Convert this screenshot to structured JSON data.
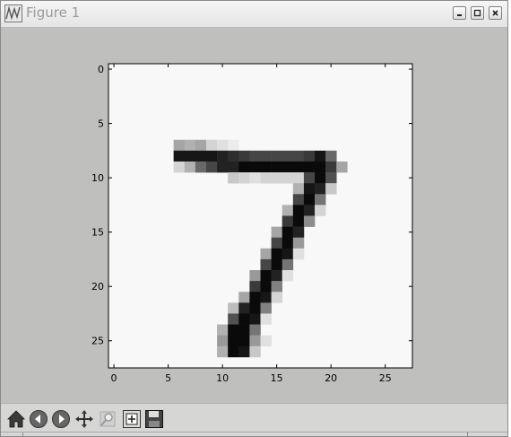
{
  "window": {
    "title": "Figure 1",
    "controls": {
      "minimize": "minimize-icon",
      "maximize": "maximize-icon",
      "close": "close-icon"
    }
  },
  "toolbar": {
    "tools": [
      {
        "id": "home",
        "icon": "home-icon"
      },
      {
        "id": "back",
        "icon": "back-arrow-icon"
      },
      {
        "id": "forward",
        "icon": "forward-arrow-icon"
      },
      {
        "id": "pan",
        "icon": "pan-icon"
      },
      {
        "id": "zoom",
        "icon": "zoom-icon"
      },
      {
        "id": "subplots",
        "icon": "subplots-icon"
      },
      {
        "id": "save",
        "icon": "save-icon"
      }
    ]
  },
  "colors": {
    "window_bg": "#c0c1bf",
    "axes_bg": "#f8f8f8",
    "ink": "#000000"
  },
  "chart_data": {
    "type": "heatmap",
    "colormap": "gray_r",
    "xlim": [
      -0.5,
      27.5
    ],
    "ylim": [
      27.5,
      -0.5
    ],
    "xticks": [
      0,
      5,
      10,
      15,
      20,
      25
    ],
    "yticks": [
      0,
      5,
      10,
      15,
      20,
      25
    ],
    "xtick_labels": [
      "0",
      "5",
      "10",
      "15",
      "20",
      "25"
    ],
    "ytick_labels": [
      "0",
      "5",
      "10",
      "15",
      "20",
      "25"
    ],
    "rows": [
      {
        "row": 7,
        "cells": [
          [
            6,
            0.35
          ],
          [
            7,
            0.3
          ],
          [
            8,
            0.35
          ],
          [
            9,
            0.15
          ],
          [
            10,
            0.1
          ],
          [
            11,
            0.05
          ]
        ]
      },
      {
        "row": 8,
        "cells": [
          [
            6,
            0.95
          ],
          [
            7,
            0.95
          ],
          [
            8,
            0.95
          ],
          [
            9,
            0.95
          ],
          [
            10,
            0.9
          ],
          [
            11,
            0.85
          ],
          [
            12,
            0.8
          ],
          [
            13,
            0.75
          ],
          [
            14,
            0.75
          ],
          [
            15,
            0.75
          ],
          [
            16,
            0.75
          ],
          [
            17,
            0.75
          ],
          [
            18,
            0.8
          ],
          [
            19,
            0.95
          ],
          [
            20,
            0.6
          ]
        ]
      },
      {
        "row": 9,
        "cells": [
          [
            6,
            0.15
          ],
          [
            7,
            0.3
          ],
          [
            8,
            0.6
          ],
          [
            9,
            0.75
          ],
          [
            10,
            0.9
          ],
          [
            11,
            0.9
          ],
          [
            12,
            1.0
          ],
          [
            13,
            1.0
          ],
          [
            14,
            1.0
          ],
          [
            15,
            1.0
          ],
          [
            16,
            1.0
          ],
          [
            17,
            1.0
          ],
          [
            18,
            1.0
          ],
          [
            19,
            1.0
          ],
          [
            20,
            0.8
          ],
          [
            21,
            0.35
          ]
        ]
      },
      {
        "row": 10,
        "cells": [
          [
            11,
            0.2
          ],
          [
            12,
            0.15
          ],
          [
            13,
            0.1
          ],
          [
            14,
            0.15
          ],
          [
            15,
            0.15
          ],
          [
            16,
            0.15
          ],
          [
            17,
            0.15
          ],
          [
            18,
            0.75
          ],
          [
            19,
            1.0
          ],
          [
            20,
            0.7
          ]
        ]
      },
      {
        "row": 11,
        "cells": [
          [
            17,
            0.3
          ],
          [
            18,
            0.95
          ],
          [
            19,
            0.9
          ],
          [
            20,
            0.2
          ]
        ]
      },
      {
        "row": 12,
        "cells": [
          [
            17,
            0.75
          ],
          [
            18,
            1.0
          ],
          [
            19,
            0.55
          ]
        ]
      },
      {
        "row": 13,
        "cells": [
          [
            16,
            0.3
          ],
          [
            17,
            1.0
          ],
          [
            18,
            0.9
          ],
          [
            19,
            0.15
          ]
        ]
      },
      {
        "row": 14,
        "cells": [
          [
            16,
            0.8
          ],
          [
            17,
            1.0
          ],
          [
            18,
            0.45
          ]
        ]
      },
      {
        "row": 15,
        "cells": [
          [
            15,
            0.35
          ],
          [
            16,
            1.0
          ],
          [
            17,
            0.9
          ]
        ]
      },
      {
        "row": 16,
        "cells": [
          [
            15,
            0.75
          ],
          [
            16,
            1.0
          ],
          [
            17,
            0.4
          ]
        ]
      },
      {
        "row": 17,
        "cells": [
          [
            14,
            0.35
          ],
          [
            15,
            1.0
          ],
          [
            16,
            0.95
          ],
          [
            17,
            0.1
          ]
        ]
      },
      {
        "row": 18,
        "cells": [
          [
            14,
            0.75
          ],
          [
            15,
            1.0
          ],
          [
            16,
            0.55
          ]
        ]
      },
      {
        "row": 19,
        "cells": [
          [
            13,
            0.4
          ],
          [
            14,
            1.0
          ],
          [
            15,
            0.9
          ],
          [
            16,
            0.1
          ]
        ]
      },
      {
        "row": 20,
        "cells": [
          [
            13,
            0.8
          ],
          [
            14,
            1.0
          ],
          [
            15,
            0.5
          ]
        ]
      },
      {
        "row": 21,
        "cells": [
          [
            12,
            0.35
          ],
          [
            13,
            1.0
          ],
          [
            14,
            0.95
          ],
          [
            15,
            0.15
          ]
        ]
      },
      {
        "row": 22,
        "cells": [
          [
            11,
            0.25
          ],
          [
            12,
            0.9
          ],
          [
            13,
            1.0
          ],
          [
            14,
            0.5
          ]
        ]
      },
      {
        "row": 23,
        "cells": [
          [
            11,
            0.7
          ],
          [
            12,
            1.0
          ],
          [
            13,
            0.95
          ],
          [
            14,
            0.1
          ]
        ]
      },
      {
        "row": 24,
        "cells": [
          [
            10,
            0.3
          ],
          [
            11,
            1.0
          ],
          [
            12,
            1.0
          ],
          [
            13,
            0.55
          ]
        ]
      },
      {
        "row": 25,
        "cells": [
          [
            10,
            0.4
          ],
          [
            11,
            1.0
          ],
          [
            12,
            1.0
          ],
          [
            13,
            0.4
          ],
          [
            14,
            0.1
          ]
        ]
      },
      {
        "row": 26,
        "cells": [
          [
            10,
            0.3
          ],
          [
            11,
            1.0
          ],
          [
            12,
            0.95
          ],
          [
            13,
            0.2
          ]
        ]
      }
    ]
  }
}
